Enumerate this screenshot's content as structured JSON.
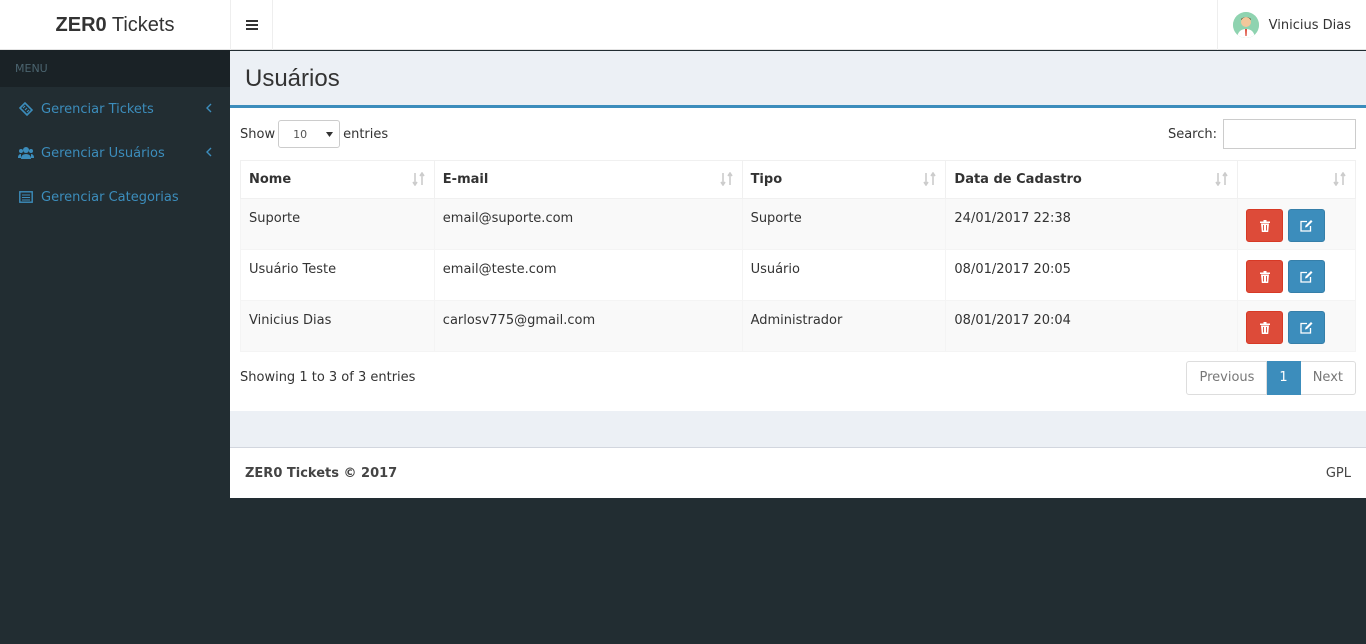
{
  "app": {
    "logo_bold": "ZER0",
    "logo_rest": " Tickets"
  },
  "header": {
    "user_name": "Vinicius Dias"
  },
  "sidebar": {
    "menu_header": "MENU",
    "items": [
      {
        "label": "Gerenciar Tickets",
        "icon": "ticket-icon",
        "has_children": true
      },
      {
        "label": "Gerenciar Usuários",
        "icon": "users-icon",
        "has_children": true
      },
      {
        "label": "Gerenciar Categorias",
        "icon": "list-icon",
        "has_children": false
      }
    ]
  },
  "page": {
    "title": "Usuários"
  },
  "table_controls": {
    "show_label": "Show",
    "page_size": "10",
    "entries_label": "entries",
    "search_label": "Search:",
    "search_value": ""
  },
  "table": {
    "columns": [
      "Nome",
      "E-mail",
      "Tipo",
      "Data de Cadastro",
      ""
    ],
    "rows": [
      {
        "nome": "Suporte",
        "email": "email@suporte.com",
        "tipo": "Suporte",
        "data": "24/01/2017 22:38"
      },
      {
        "nome": "Usuário Teste",
        "email": "email@teste.com",
        "tipo": "Usuário",
        "data": "08/01/2017 20:05"
      },
      {
        "nome": "Vinicius Dias",
        "email": "carlosv775@gmail.com",
        "tipo": "Administrador",
        "data": "08/01/2017 20:04"
      }
    ]
  },
  "pagination": {
    "info": "Showing 1 to 3 of 3 entries",
    "previous": "Previous",
    "current": "1",
    "next": "Next"
  },
  "footer": {
    "left": "ZER0 Tickets © 2017",
    "right": "GPL"
  },
  "colors": {
    "primary": "#3c8dbc",
    "danger": "#dd4b39",
    "sidebar": "#222d32",
    "content_bg": "#ecf0f5"
  }
}
